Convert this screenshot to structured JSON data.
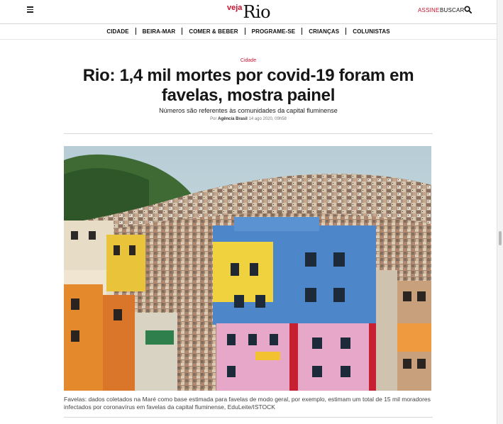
{
  "header": {
    "logo_small": "veja",
    "logo_large": "Rio",
    "subscribe_label": "ASSINE",
    "search_label": "BUSCAR"
  },
  "nav": {
    "items": [
      "CIDADE",
      "BEIRA-MAR",
      "COMER & BEBER",
      "PROGRAME-SE",
      "CRIANÇAS",
      "COLUNISTAS"
    ]
  },
  "article": {
    "category": "Cidade",
    "headline": "Rio: 1,4 mil mortes por covid-19 foram em favelas, mostra painel",
    "subtitle": "Números são referentes às comunidades da capital fluminense",
    "byline_prefix": "Por",
    "author": "Agência Brasil",
    "date": "14 ago 2020, 09h58",
    "caption": "Favelas: dados coletados na Maré como base estimada para favelas de modo geral, por exemplo, estimam um total de 15 mil moradores infectados por coronavírus em favelas da capital fluminense, EduLeite/ISTOCK"
  },
  "colors": {
    "brand_red": "#c4122e",
    "text": "#111111"
  },
  "icons": [
    "hamburger-menu-icon",
    "search-icon"
  ]
}
